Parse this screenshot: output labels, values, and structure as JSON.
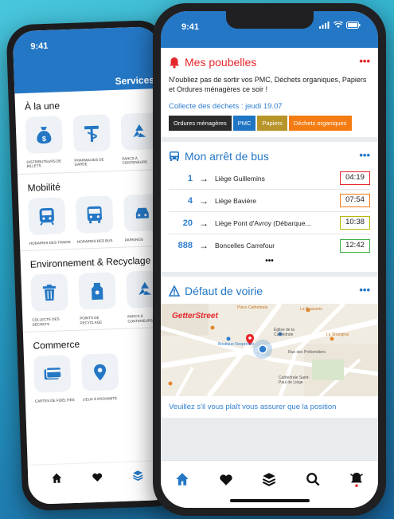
{
  "colors": {
    "brand_blue": "#2477c5",
    "alert_red": "#e5262b",
    "link_blue": "#2f7ed0",
    "tag_black": "#2b2b2b",
    "tag_blue": "#1f75c4",
    "tag_olive": "#b8952a",
    "tag_orange": "#f57c12"
  },
  "back_phone": {
    "time": "9:41",
    "title": "Services",
    "sections": [
      {
        "title": "À la une",
        "tiles": [
          {
            "icon": "money-bag-icon",
            "label": "DISTRIBUTEURS DE BILLETS"
          },
          {
            "icon": "pharmacy-icon",
            "label": "PHARMACIES DE GARDE"
          },
          {
            "icon": "recycle-icon",
            "label": "PARCS À CONTENEURS"
          }
        ]
      },
      {
        "title": "Mobilité",
        "tiles": [
          {
            "icon": "train-icon",
            "label": "HORAIRES DES TRAINS"
          },
          {
            "icon": "bus-icon",
            "label": "HORAIRES DES BUS"
          },
          {
            "icon": "car-icon",
            "label": "PARKINGS"
          }
        ]
      },
      {
        "title": "Environnement & Recyclage",
        "tiles": [
          {
            "icon": "trash-icon",
            "label": "COLLECTE DES DÉCHETS"
          },
          {
            "icon": "recycling-point-icon",
            "label": "POINTS DE RECYCLAGE"
          },
          {
            "icon": "recycle-icon",
            "label": "PARCS À CONTENEURS"
          }
        ]
      },
      {
        "title": "Commerce",
        "tiles": [
          {
            "icon": "card-icon",
            "label": "CARTES DE FIDÉLITÉS"
          },
          {
            "icon": "location-pin-icon",
            "label": "LIEUX À PROXIMITÉ"
          }
        ]
      }
    ]
  },
  "front_phone": {
    "time": "9:41",
    "trash_card": {
      "title": "Mes poubelles",
      "more": "•••",
      "message": "N'oubliez pas de sortir vos PMC, Déchets organiques, Papiers et Ordures ménagères ce soir !",
      "collect": "Collecte des déchets : jeudi 19.07",
      "tags": [
        {
          "label": "Ordures ménagères",
          "color": "#2b2b2b"
        },
        {
          "label": "PMC",
          "color": "#1f75c4"
        },
        {
          "label": "Papiers",
          "color": "#b8952a"
        },
        {
          "label": "Déchets organiques",
          "color": "#f57c12"
        }
      ]
    },
    "bus_card": {
      "title": "Mon arrêt de bus",
      "more": "•••",
      "arrow": "→",
      "rows": [
        {
          "line": "1",
          "dest": "Liège Guillemins",
          "time": "04:19",
          "color": "#e5262b"
        },
        {
          "line": "4",
          "dest": "Liège Bavière",
          "time": "07:54",
          "color": "#f57c12"
        },
        {
          "line": "20",
          "dest": "Liège Pont d'Avroy (Débarque...",
          "time": "10:38",
          "color": "#b6b800"
        },
        {
          "line": "888",
          "dest": "Boncelles Carrefour",
          "time": "12:42",
          "color": "#3fb24a"
        }
      ],
      "more_rows": "•••"
    },
    "road_card": {
      "title": "Défaut de voirie",
      "more": "•••",
      "map_labels": {
        "brand": "GetterStreet",
        "place1": "Place Cathédrale",
        "place2": "La Brasserie",
        "place3": "Le Shanghai",
        "place4": "Église de la Cathédrale",
        "place5": "Boutique Nespresso",
        "place6": "Rue des Prébendiers",
        "place7": "Cathédrale Saint-Paul de Liège"
      },
      "message": "Veuillez s'il vous plaît vous assurer que la position"
    }
  }
}
